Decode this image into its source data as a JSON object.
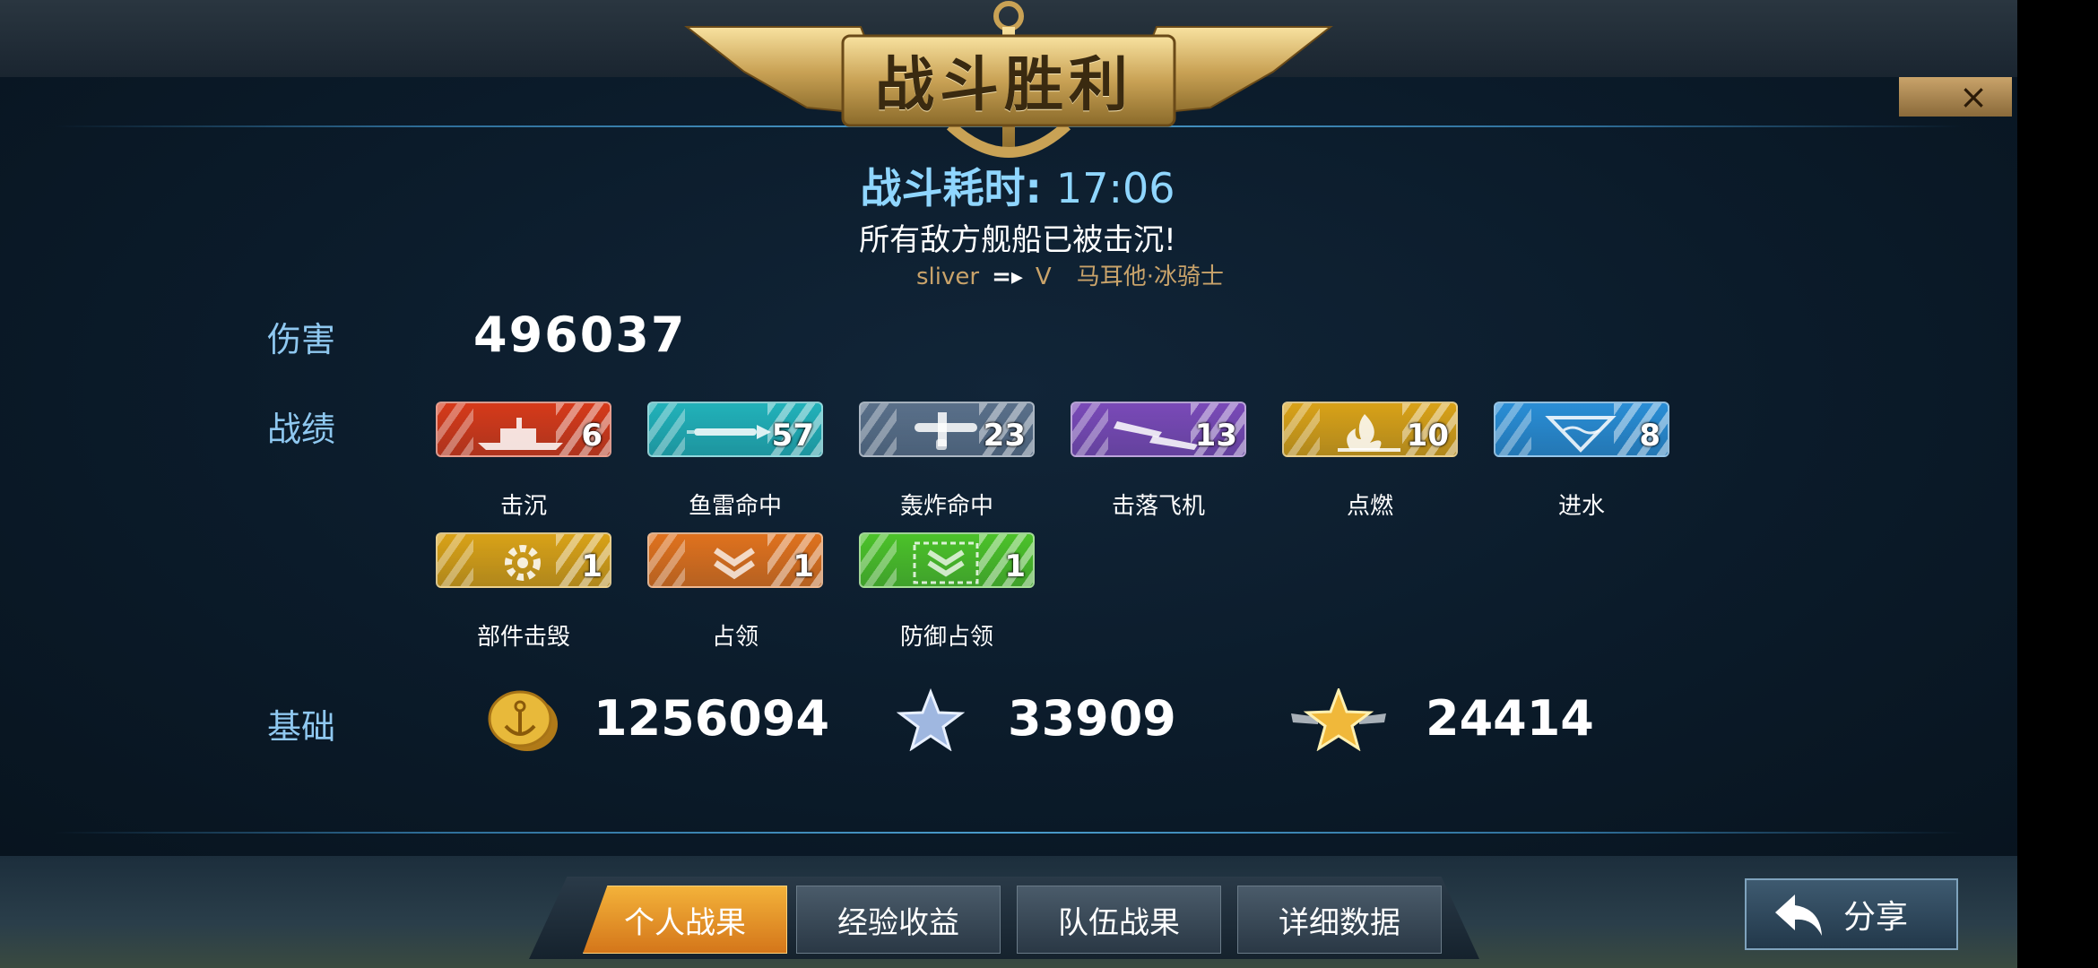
{
  "header": {
    "title": "战斗胜利",
    "close_icon": "×"
  },
  "battle": {
    "time_label": "战斗耗时: ",
    "time_value": "17:06",
    "message": "所有敌方舰船已被击沉!",
    "player_name": "sliver",
    "tier": "V",
    "ship_name": "马耳他·冰骑士"
  },
  "damage": {
    "label": "伤害",
    "value": "496037"
  },
  "record": {
    "label": "战绩",
    "badges": [
      {
        "name": "击沉",
        "count": "6",
        "icon": "sink-ship-icon",
        "color": "#d63a1a"
      },
      {
        "name": "鱼雷命中",
        "count": "57",
        "icon": "torpedo-icon",
        "color": "#22b2ba"
      },
      {
        "name": "轰炸命中",
        "count": "23",
        "icon": "bomber-icon",
        "color": "#5a708a"
      },
      {
        "name": "击落飞机",
        "count": "13",
        "icon": "planes-shot-icon",
        "color": "#7a4ab8"
      },
      {
        "name": "点燃",
        "count": "10",
        "icon": "fire-icon",
        "color": "#d9a218"
      },
      {
        "name": "进水",
        "count": "8",
        "icon": "flooding-icon",
        "color": "#2a8ed6"
      },
      {
        "name": "部件击毁",
        "count": "1",
        "icon": "gear-destroy-icon",
        "color": "#d9a218"
      },
      {
        "name": "占领",
        "count": "1",
        "icon": "capture-chevron-icon",
        "color": "#e0721e"
      },
      {
        "name": "防御占领",
        "count": "1",
        "icon": "defend-capture-icon",
        "color": "#4cc22a"
      }
    ]
  },
  "basics": {
    "label": "基础",
    "coins": "1256094",
    "coins_icon": "anchor-coin-icon",
    "exp": "33909",
    "exp_icon": "silver-star-icon",
    "commander_exp": "24414",
    "commander_exp_icon": "gold-winged-star-icon"
  },
  "tabs": [
    {
      "label": "个人战果",
      "active": true
    },
    {
      "label": "经验收益",
      "active": false
    },
    {
      "label": "队伍战果",
      "active": false
    },
    {
      "label": "详细数据",
      "active": false
    }
  ],
  "share": {
    "label": "分享",
    "icon": "return-arrow-icon"
  }
}
